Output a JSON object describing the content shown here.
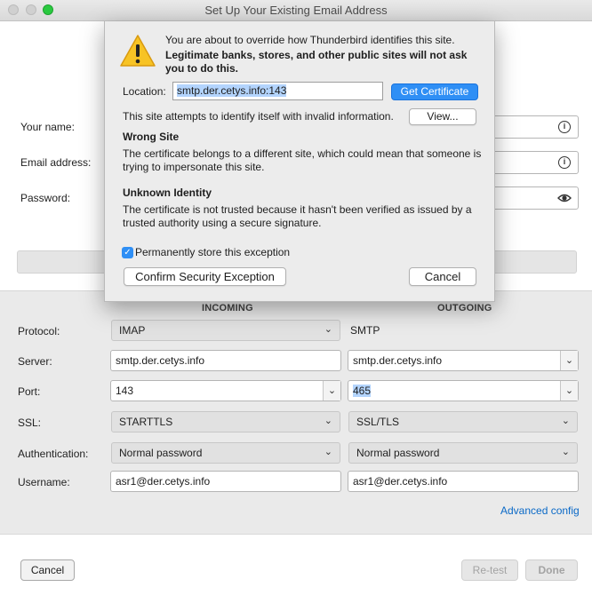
{
  "window": {
    "title": "Set Up Your Existing Email Address"
  },
  "account": {
    "name_label": "Your name:",
    "email_label": "Email address:",
    "password_label": "Password:"
  },
  "dialog": {
    "line1": "You are about to override how Thunderbird identifies this site.",
    "line2": "Legitimate banks, stores, and other public sites will not ask you to do this.",
    "location_label": "Location:",
    "location_value": "smtp.der.cetys.info:143",
    "get_certificate": "Get Certificate",
    "invalid_info": "This site attempts to identify itself with invalid information.",
    "view_button": "View...",
    "wrong_site_heading": "Wrong Site",
    "wrong_site_text": "The certificate belongs to a different site, which could mean that someone is trying to impersonate this site.",
    "unknown_heading": "Unknown Identity",
    "unknown_text": "The certificate is not trusted because it hasn't been verified as issued by a trusted authority using a secure signature.",
    "permanent_label": "Permanently store this exception",
    "permanent_checked": true,
    "confirm_button": "Confirm Security Exception",
    "cancel_button": "Cancel"
  },
  "config": {
    "incoming_head": "INCOMING",
    "outgoing_head": "OUTGOING",
    "protocol_label": "Protocol:",
    "server_label": "Server:",
    "port_label": "Port:",
    "ssl_label": "SSL:",
    "auth_label": "Authentication:",
    "username_label": "Username:",
    "incoming": {
      "protocol": "IMAP",
      "server": "smtp.der.cetys.info",
      "port": "143",
      "ssl": "STARTTLS",
      "auth": "Normal password",
      "username": "asr1@der.cetys.info"
    },
    "outgoing": {
      "protocol": "SMTP",
      "server": "smtp.der.cetys.info",
      "port": "465",
      "ssl": "SSL/TLS",
      "auth": "Normal password",
      "username": "asr1@der.cetys.info"
    },
    "advanced_link": "Advanced config"
  },
  "footer": {
    "cancel": "Cancel",
    "retest": "Re-test",
    "done": "Done"
  },
  "colors": {
    "accent": "#2f8ff5",
    "link": "#0a69c7",
    "selection": "#b3d4fd"
  }
}
